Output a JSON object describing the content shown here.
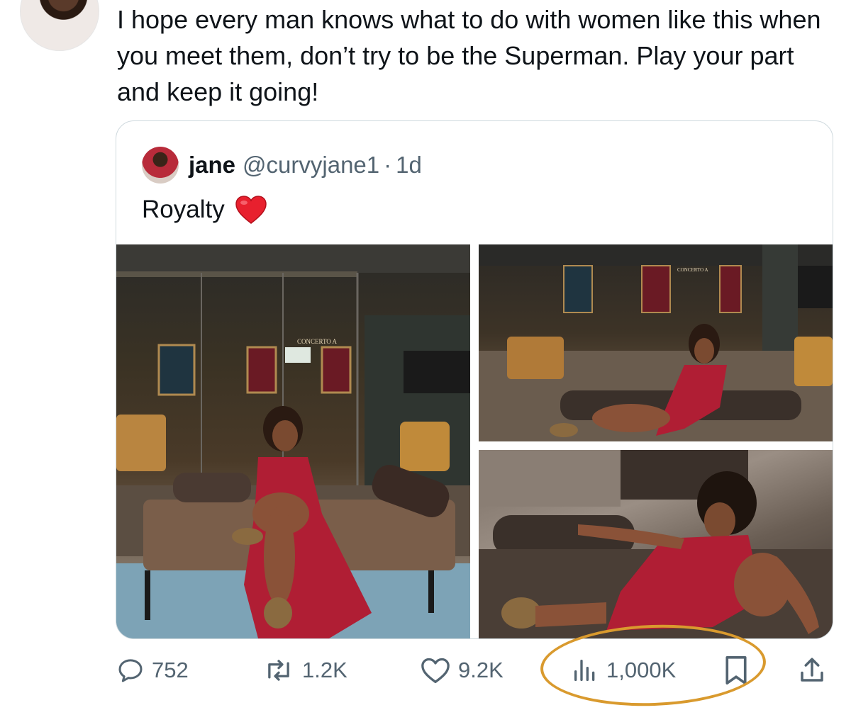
{
  "tweet": {
    "text": "I hope every man knows what to do with women like this when you meet them, don’t try to be the Superman. Play your part and keep it going!"
  },
  "quoted_tweet": {
    "name": "jane",
    "handle": "@curvyjane1",
    "separator": "·",
    "time": "1d",
    "text": "Royalty"
  },
  "photos": {
    "photo1_sign": "CONCERTO A",
    "photo2_sign": "CONCERTO A"
  },
  "actions": {
    "replies": "752",
    "reposts": "1.2K",
    "likes": "9.2K",
    "views": "1,000K"
  },
  "colors": {
    "text_primary": "#0f1419",
    "text_secondary": "#536471",
    "card_border": "#cfd9de",
    "annotation": "#d99a2e",
    "dress_red": "#b01e34"
  },
  "icons": [
    "reply-icon",
    "repost-icon",
    "like-icon",
    "views-icon",
    "bookmark-icon",
    "share-icon",
    "heart-emoji-icon"
  ]
}
